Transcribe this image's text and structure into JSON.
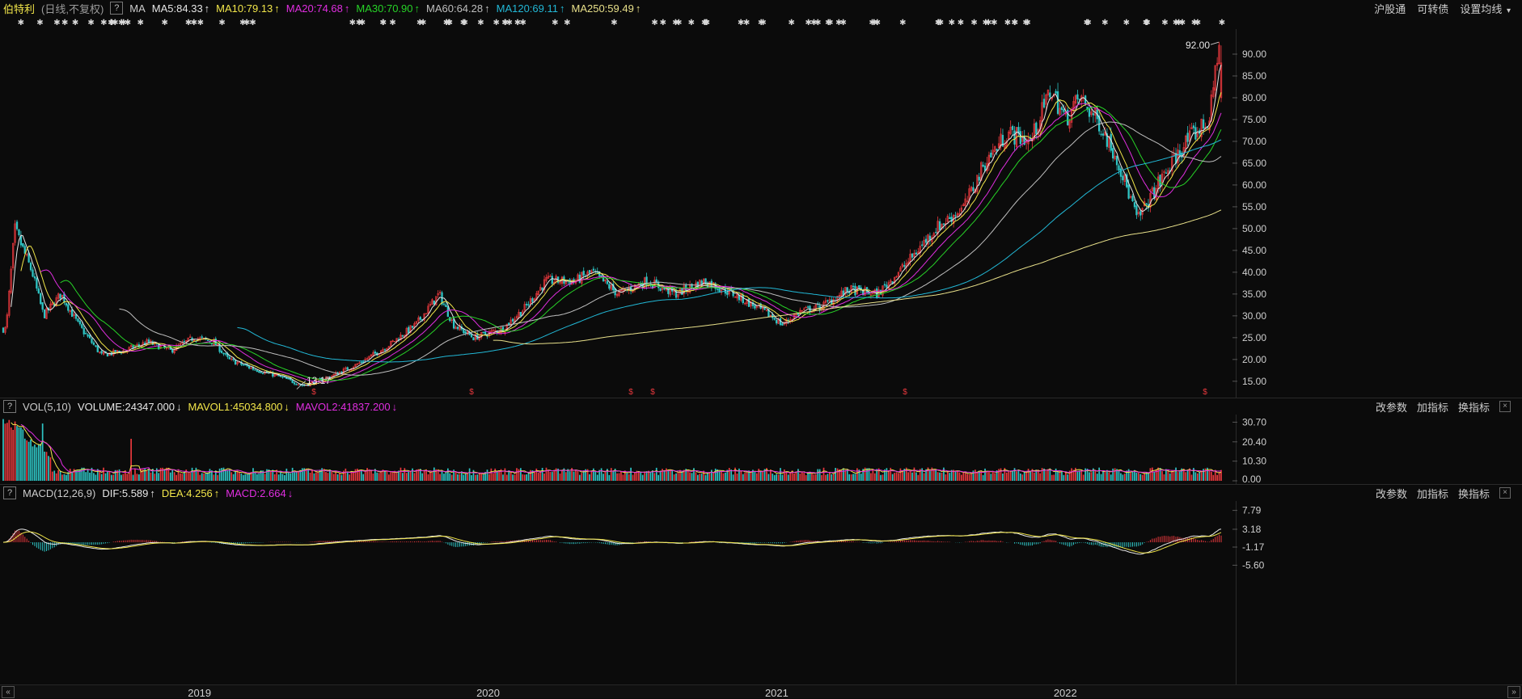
{
  "stock": {
    "name": "伯特利",
    "mode": "(日线,不复权)",
    "help": "?"
  },
  "ma_indicator": {
    "label": "MA",
    "items": [
      {
        "text": "MA5:84.33",
        "arrow": "↑",
        "color": "#e6e6e6"
      },
      {
        "text": "MA10:79.13",
        "arrow": "↑",
        "color": "#f2e64a"
      },
      {
        "text": "MA20:74.68",
        "arrow": "↑",
        "color": "#e02ee0"
      },
      {
        "text": "MA30:70.90",
        "arrow": "↑",
        "color": "#27d327"
      },
      {
        "text": "MA60:64.28",
        "arrow": "↑",
        "color": "#bfbfbf"
      },
      {
        "text": "MA120:69.11",
        "arrow": "↑",
        "color": "#22b8d6"
      },
      {
        "text": "MA250:59.49",
        "arrow": "↑",
        "color": "#e8e08a"
      }
    ]
  },
  "toolbar": {
    "hugutong": "沪股通",
    "convertible": "可转债",
    "ma_settings": "设置均线",
    "settings_arrow": "▾"
  },
  "price_chart": {
    "y_ticks": [
      "90.00",
      "85.00",
      "80.00",
      "75.00",
      "70.00",
      "65.00",
      "60.00",
      "55.00",
      "50.00",
      "45.00",
      "40.00",
      "35.00",
      "30.00",
      "25.00",
      "20.00",
      "15.00"
    ],
    "high_label": "92.00",
    "low_label": "13.17"
  },
  "vol_panel": {
    "help": "?",
    "name": "VOL(5,10)",
    "items": [
      {
        "text": "VOLUME:24347.000",
        "arrow": "↓",
        "color": "#e6e6e6"
      },
      {
        "text": "MAVOL1:45034.800",
        "arrow": "↓",
        "color": "#f2e64a"
      },
      {
        "text": "MAVOL2:41837.200",
        "arrow": "↓",
        "color": "#e02ee0"
      }
    ],
    "y_ticks": [
      "30.70",
      "20.40",
      "10.30",
      "0.00"
    ],
    "btn_params": "改参数",
    "btn_add": "加指标",
    "btn_switch": "换指标",
    "close": "×"
  },
  "macd_panel": {
    "help": "?",
    "name": "MACD(12,26,9)",
    "items": [
      {
        "text": "DIF:5.589",
        "arrow": "↑",
        "color": "#e6e6e6"
      },
      {
        "text": "DEA:4.256",
        "arrow": "↑",
        "color": "#f2e64a"
      },
      {
        "text": "MACD:2.664",
        "arrow": "↓",
        "color": "#e02ee0"
      }
    ],
    "y_ticks": [
      "7.79",
      "3.18",
      "-1.17",
      "-5.60"
    ],
    "btn_params": "改参数",
    "btn_add": "加指标",
    "btn_switch": "换指标",
    "close": "×"
  },
  "x_axis": {
    "years": [
      "2019",
      "2020",
      "2021",
      "2022"
    ],
    "left_btn": "«",
    "right_btn": "»"
  },
  "colors": {
    "up": "#e8383d",
    "down": "#2ec4c4",
    "bg": "#0b0b0b",
    "grid": "#2a2a2a"
  },
  "chart_data": {
    "type": "candlestick",
    "price_axis": {
      "min": 12,
      "max": 95
    },
    "price_path": [
      [
        2018.33,
        27
      ],
      [
        2018.36,
        50
      ],
      [
        2018.42,
        40
      ],
      [
        2018.46,
        30
      ],
      [
        2018.52,
        35
      ],
      [
        2018.58,
        28
      ],
      [
        2018.66,
        21
      ],
      [
        2018.74,
        22
      ],
      [
        2018.82,
        24
      ],
      [
        2018.9,
        22
      ],
      [
        2018.98,
        25
      ],
      [
        2019.05,
        24
      ],
      [
        2019.1,
        20
      ],
      [
        2019.18,
        18
      ],
      [
        2019.28,
        16
      ],
      [
        2019.36,
        14
      ],
      [
        2019.45,
        16
      ],
      [
        2019.55,
        19
      ],
      [
        2019.65,
        23
      ],
      [
        2019.75,
        28
      ],
      [
        2019.83,
        35
      ],
      [
        2019.88,
        28
      ],
      [
        2019.95,
        25
      ],
      [
        2020.05,
        27
      ],
      [
        2020.13,
        32
      ],
      [
        2020.2,
        38
      ],
      [
        2020.3,
        38
      ],
      [
        2020.36,
        40
      ],
      [
        2020.45,
        35
      ],
      [
        2020.55,
        38
      ],
      [
        2020.65,
        35
      ],
      [
        2020.75,
        38
      ],
      [
        2020.85,
        35
      ],
      [
        2020.98,
        30
      ],
      [
        2021.02,
        28
      ],
      [
        2021.08,
        31
      ],
      [
        2021.15,
        32
      ],
      [
        2021.25,
        36
      ],
      [
        2021.35,
        35
      ],
      [
        2021.45,
        42
      ],
      [
        2021.55,
        50
      ],
      [
        2021.65,
        55
      ],
      [
        2021.72,
        65
      ],
      [
        2021.8,
        72
      ],
      [
        2021.88,
        70
      ],
      [
        2021.95,
        82
      ],
      [
        2022.0,
        75
      ],
      [
        2022.05,
        80
      ],
      [
        2022.12,
        74
      ],
      [
        2022.18,
        66
      ],
      [
        2022.25,
        52
      ],
      [
        2022.32,
        60
      ],
      [
        2022.38,
        66
      ],
      [
        2022.42,
        70
      ],
      [
        2022.5,
        75
      ],
      [
        2022.53,
        92
      ]
    ],
    "ma_series": [
      {
        "name": "MA5",
        "color": "#e6e6e6"
      },
      {
        "name": "MA10",
        "color": "#f2e64a"
      },
      {
        "name": "MA20",
        "color": "#e02ee0"
      },
      {
        "name": "MA30",
        "color": "#27d327"
      },
      {
        "name": "MA60",
        "color": "#bfbfbf"
      },
      {
        "name": "MA120",
        "color": "#22b8d6"
      },
      {
        "name": "MA250",
        "color": "#e8e08a"
      }
    ],
    "vol_axis": {
      "min": 0,
      "max": 33
    },
    "macd_axis": {
      "min": -6.5,
      "max": 8.5
    },
    "x_range": [
      2018.32,
      2022.54
    ]
  }
}
